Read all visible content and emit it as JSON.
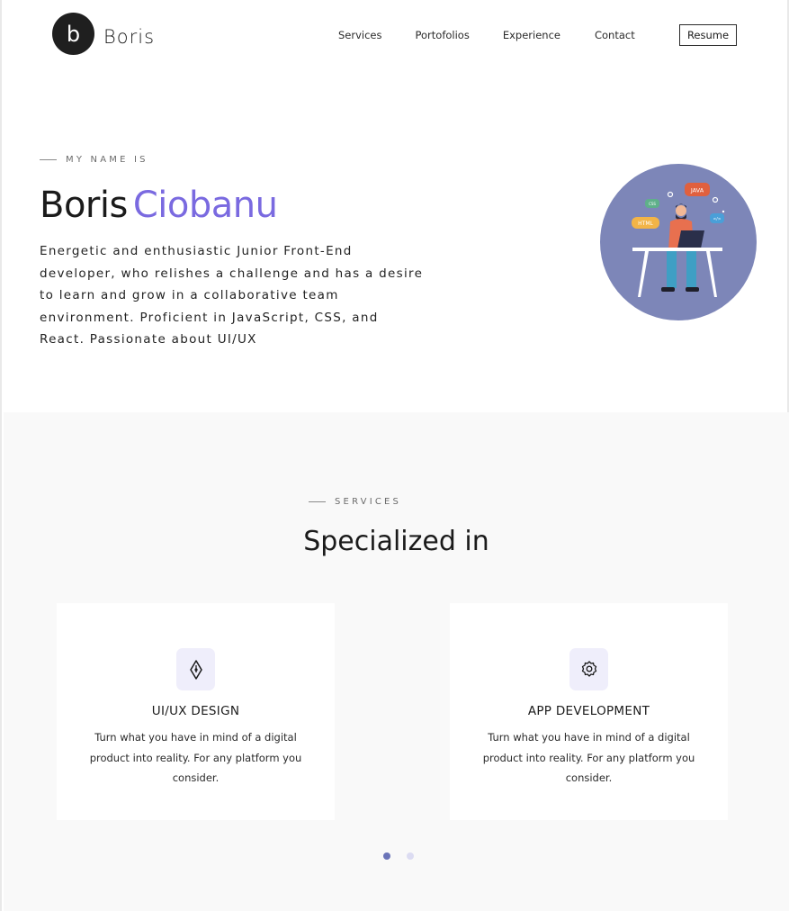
{
  "header": {
    "logo_letter": "b",
    "logo_text": "Boris",
    "nav": [
      "Services",
      "Portofolios",
      "Experience",
      "Contact"
    ],
    "resume_label": "Resume"
  },
  "hero": {
    "eyebrow": "MY NAME IS",
    "first_name": "Boris",
    "last_name": "Ciobanu",
    "bio": "Energetic and enthusiastic Junior Front-End developer, who relishes a challenge and has a desire to learn and grow in a collaborative team environment. Proficient in JavaScript, CSS, and React. Passionate about UI/UX",
    "illustration_labels": [
      "JAVA",
      "HTML",
      "CSS",
      "</>"
    ]
  },
  "services": {
    "eyebrow": "SERVICES",
    "title": "Specialized in",
    "cards": [
      {
        "icon": "pen-nib-icon",
        "title": "UI/UX DESIGN",
        "description": "Turn what you have in mind of a digital product into reality. For any platform you consider."
      },
      {
        "icon": "gear-icon",
        "title": "APP DEVELOPMENT",
        "description": "Turn what you have in mind of a digital product into reality. For any platform you consider."
      }
    ],
    "carousel_dots": [
      true,
      false
    ]
  },
  "colors": {
    "accent": "#7a6ae0",
    "avatar_bg": "#7d86b8",
    "dot_active": "#6a74b8",
    "dot_inactive": "#dcdcf2",
    "icon_bg": "#efeefb",
    "section_bg": "#f9f9f9"
  }
}
